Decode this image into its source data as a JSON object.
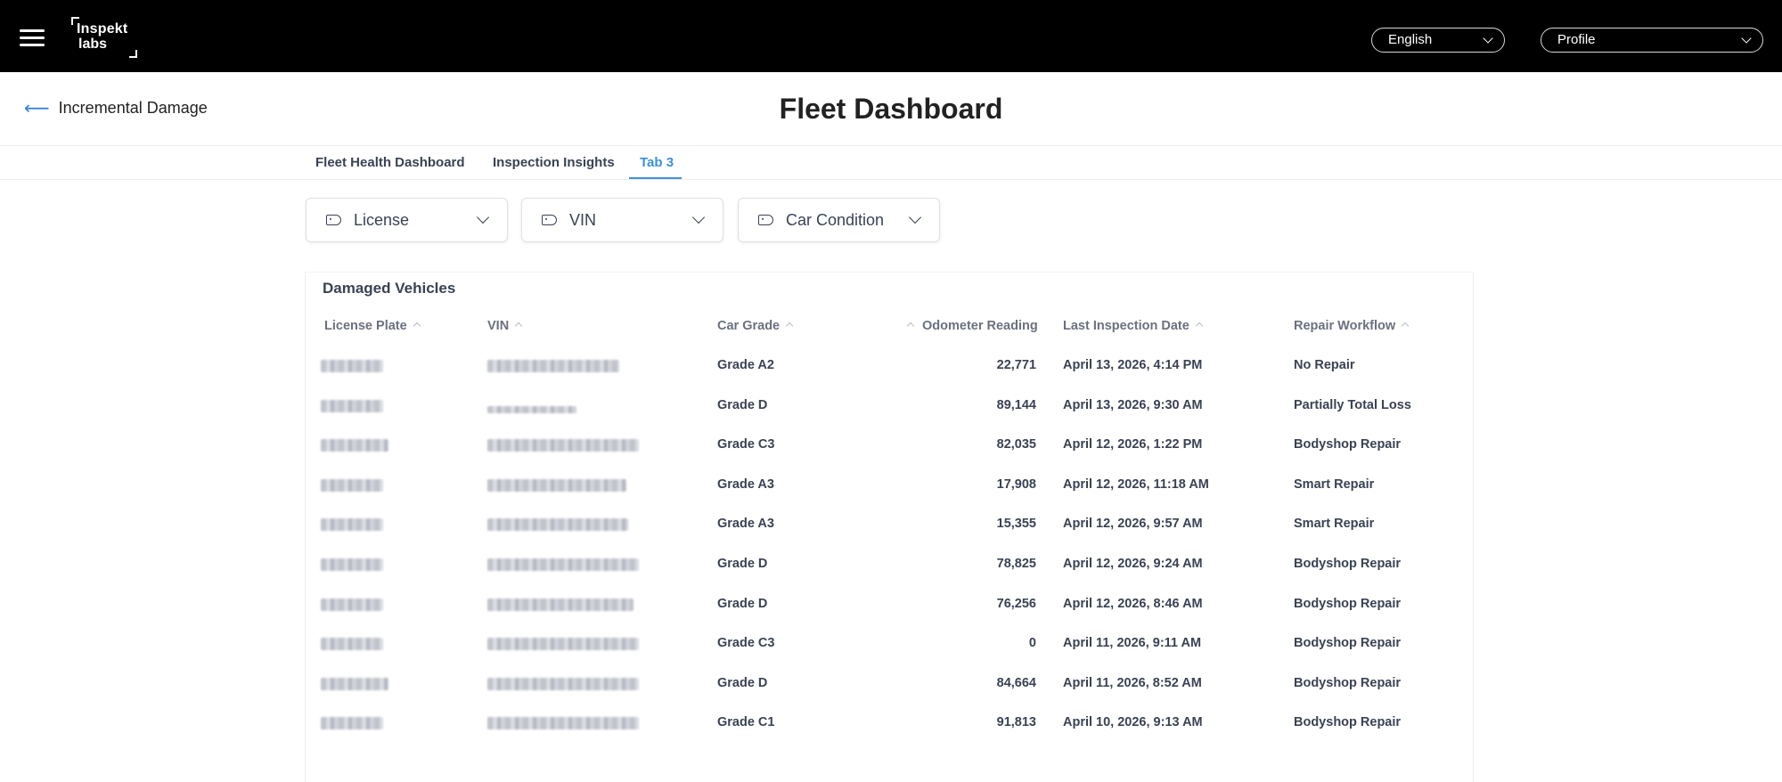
{
  "header": {
    "logo_line1": "Inspekt",
    "logo_line2": "labs",
    "language": "English",
    "profile": "Profile"
  },
  "back_link": "Incremental Damage",
  "page_title": "Fleet Dashboard",
  "tabs": [
    {
      "label": "Fleet Health Dashboard",
      "active": false
    },
    {
      "label": "Inspection Insights",
      "active": false
    },
    {
      "label": "Tab 3",
      "active": true
    }
  ],
  "filters": [
    {
      "label": "License",
      "icon": "tag-icon"
    },
    {
      "label": "VIN",
      "icon": "tag-icon"
    },
    {
      "label": "Car Condition",
      "icon": "tag-icon"
    }
  ],
  "table": {
    "title": "Damaged Vehicles",
    "columns": [
      "License Plate",
      "VIN",
      "Car Grade",
      "Odometer Reading",
      "Last Inspection Date",
      "Repair Workflow"
    ],
    "rows": [
      {
        "grade": "Grade A2",
        "odometer": "22,771",
        "date": "April 13, 2026, 4:14 PM",
        "workflow": "No Repair"
      },
      {
        "grade": "Grade D",
        "odometer": "89,144",
        "date": "April 13, 2026, 9:30 AM",
        "workflow": "Partially Total Loss"
      },
      {
        "grade": "Grade C3",
        "odometer": "82,035",
        "date": "April 12, 2026, 1:22 PM",
        "workflow": "Bodyshop Repair"
      },
      {
        "grade": "Grade A3",
        "odometer": "17,908",
        "date": "April 12, 2026, 11:18 AM",
        "workflow": "Smart Repair"
      },
      {
        "grade": "Grade A3",
        "odometer": "15,355",
        "date": "April 12, 2026, 9:57 AM",
        "workflow": "Smart Repair"
      },
      {
        "grade": "Grade D",
        "odometer": "78,825",
        "date": "April 12, 2026, 9:24 AM",
        "workflow": "Bodyshop Repair"
      },
      {
        "grade": "Grade D",
        "odometer": "76,256",
        "date": "April 12, 2026, 8:46 AM",
        "workflow": "Bodyshop Repair"
      },
      {
        "grade": "Grade C3",
        "odometer": "0",
        "date": "April 11, 2026, 9:11 AM",
        "workflow": "Bodyshop Repair"
      },
      {
        "grade": "Grade D",
        "odometer": "84,664",
        "date": "April 11, 2026, 8:52 AM",
        "workflow": "Bodyshop Repair"
      },
      {
        "grade": "Grade C1",
        "odometer": "91,813",
        "date": "April 10, 2026, 9:13 AM",
        "workflow": "Bodyshop Repair"
      }
    ]
  },
  "colors": {
    "topbar": "#000000",
    "accent": "#3d8fdc",
    "text": "#3a4254"
  }
}
